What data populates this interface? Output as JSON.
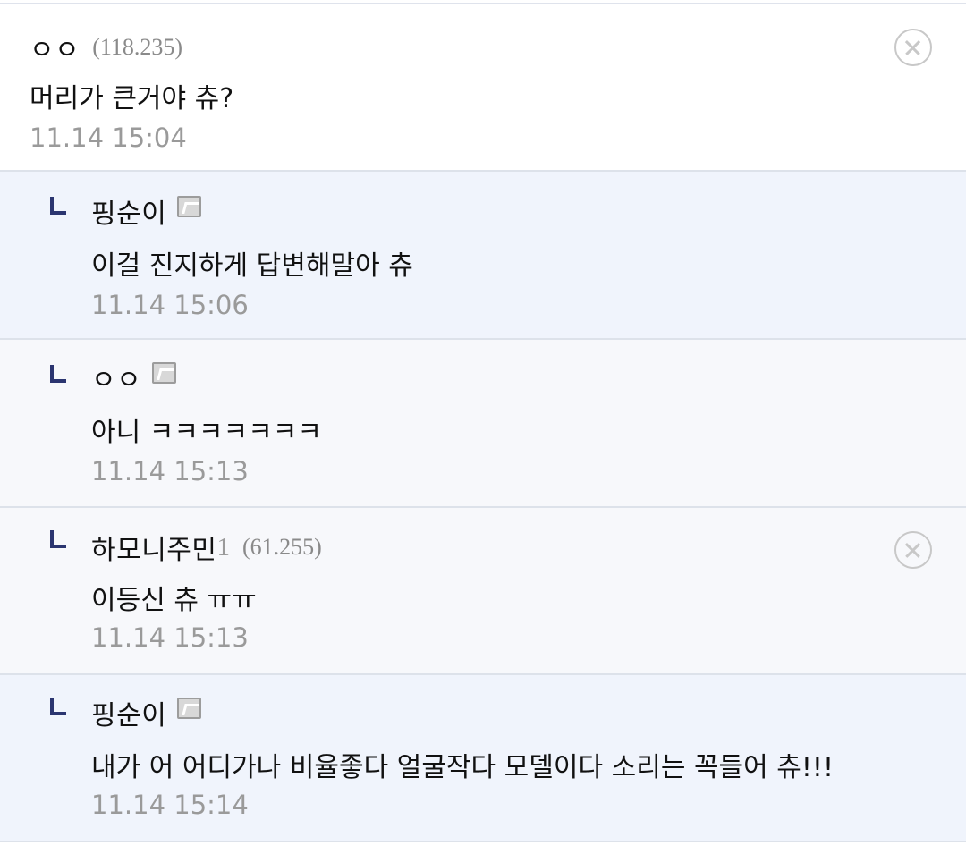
{
  "comments": [
    {
      "nick": "ㅇㅇ",
      "ip": "(118.235)",
      "body": "머리가 큰거야 츄?",
      "time": "11.14 15:04",
      "delete_icon": "close-circle-icon"
    },
    {
      "nick": "핑순이",
      "badge_icon": "fixed-nick-icon",
      "body": "이걸 진지하게 답변해말아 츄",
      "time": "11.14 15:06"
    },
    {
      "nick": "ㅇㅇ",
      "badge_icon": "fixed-nick-icon",
      "body": "아니 ㅋㅋㅋㅋㅋㅋㅋ",
      "time": "11.14 15:13"
    },
    {
      "nick": "하모니주민",
      "nick_suffix": "1",
      "ip": "(61.255)",
      "body": "이등신 츄 ㅠㅠ",
      "time": "11.14 15:13",
      "delete_icon": "close-circle-icon"
    },
    {
      "nick": "핑순이",
      "badge_icon": "fixed-nick-icon",
      "body": "내가 어 어디가나 비율좋다 얼굴작다 모델이다 소리는 꼭들어 츄!!!",
      "time": "11.14 15:14"
    }
  ],
  "colors": {
    "reply_mark": "#2b3570",
    "reply_bg_blue": "#f0f4fc",
    "reply_bg_gray": "#f7f8fb",
    "meta_gray": "#9a9a9a"
  }
}
